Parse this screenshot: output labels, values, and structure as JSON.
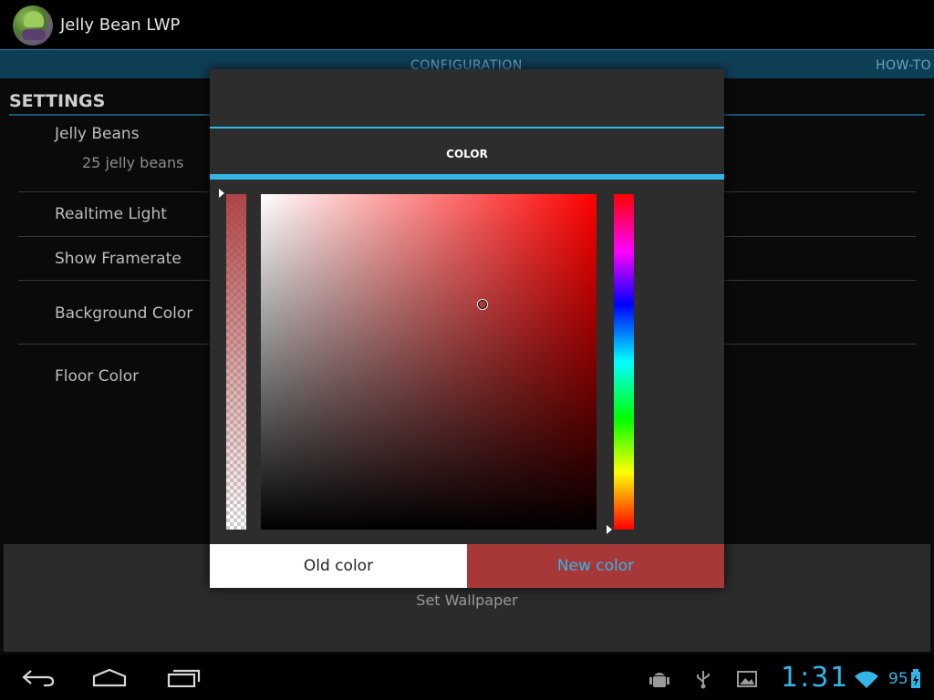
{
  "app": {
    "title": "Jelly Bean LWP"
  },
  "tabs": [
    {
      "label": "CONFIGURATION"
    },
    {
      "label": "HOW-TO"
    }
  ],
  "settings": {
    "header": "SETTINGS",
    "items": [
      {
        "title": "Jelly Beans",
        "summary": "25 jelly beans"
      },
      {
        "title": "Realtime Light"
      },
      {
        "title": "Show Framerate"
      },
      {
        "title": "Background Color"
      },
      {
        "title": "Floor Color"
      }
    ]
  },
  "set_wallpaper_label": "Set Wallpaper",
  "dialog": {
    "tab_label": "COLOR",
    "old_color_label": "Old color",
    "new_color_label": "New color",
    "new_color_value": "#a83838",
    "hue_color": "#ff0000"
  },
  "status": {
    "clock": "1:31",
    "battery": "95"
  },
  "icons": [
    "app-icon",
    "back-icon",
    "home-icon",
    "recent-apps-icon",
    "android-debug-icon",
    "usb-icon",
    "image-notification-icon",
    "wifi-icon",
    "battery-charging-icon"
  ],
  "colors": {
    "accent": "#33b5e5",
    "tab_bar": "#0f3e57"
  }
}
